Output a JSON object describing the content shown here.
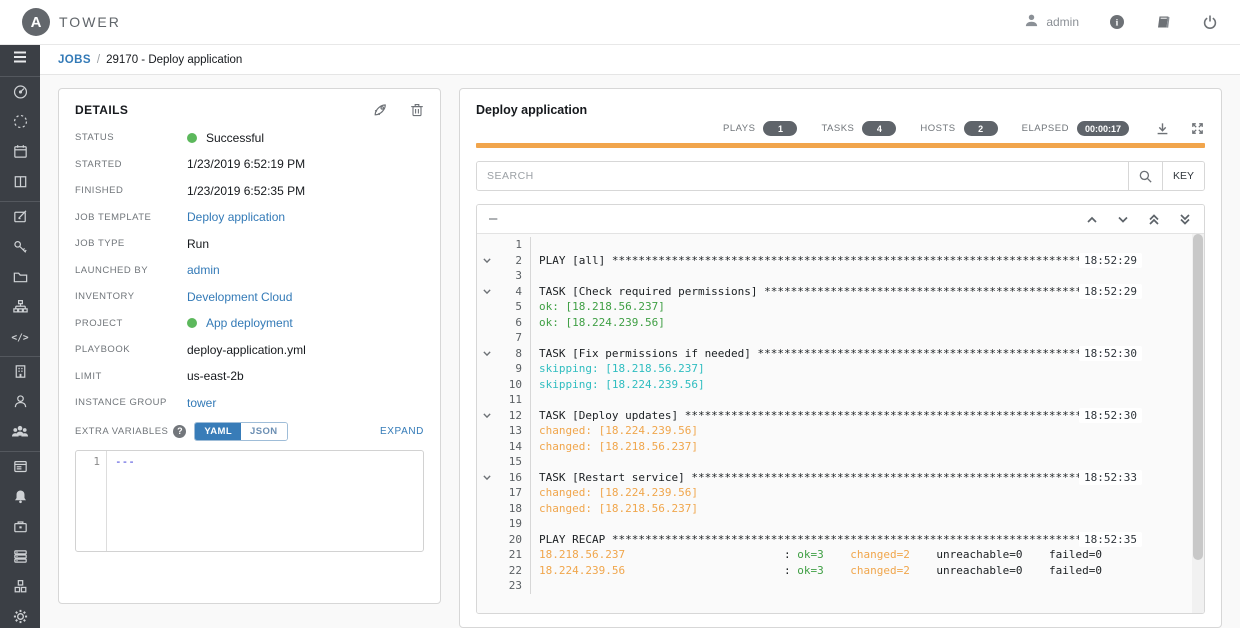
{
  "topbar": {
    "brand_letter": "A",
    "brand": "TOWER",
    "user": "admin",
    "icons": [
      "user-icon",
      "info-icon",
      "docs-icon",
      "power-icon"
    ]
  },
  "breadcrumb": {
    "root": "JOBS",
    "separator": "/",
    "current": "29170 - Deploy application"
  },
  "sidebar": {
    "items": [
      {
        "icon": "menu"
      },
      {
        "divider": true
      },
      {
        "icon": "dashboard"
      },
      {
        "icon": "jobs"
      },
      {
        "icon": "schedules"
      },
      {
        "icon": "portal"
      },
      {
        "divider": true
      },
      {
        "icon": "templates"
      },
      {
        "icon": "credentials"
      },
      {
        "icon": "projects"
      },
      {
        "icon": "inventories"
      },
      {
        "icon": "inventory-scripts"
      },
      {
        "divider": true
      },
      {
        "icon": "organizations"
      },
      {
        "icon": "users"
      },
      {
        "icon": "teams"
      },
      {
        "divider": true
      },
      {
        "icon": "credential-types"
      },
      {
        "icon": "notifications"
      },
      {
        "icon": "management-jobs"
      },
      {
        "icon": "instance-groups"
      },
      {
        "icon": "applications"
      },
      {
        "icon": "settings"
      }
    ]
  },
  "details": {
    "title": "DETAILS",
    "action_icons": [
      "relaunch-icon",
      "delete-icon"
    ],
    "rows": [
      {
        "label": "STATUS",
        "value": "Successful",
        "type": "status"
      },
      {
        "label": "STARTED",
        "value": "1/23/2019 6:52:19 PM",
        "type": "text"
      },
      {
        "label": "FINISHED",
        "value": "1/23/2019 6:52:35 PM",
        "type": "text"
      },
      {
        "label": "JOB TEMPLATE",
        "value": "Deploy application",
        "type": "link"
      },
      {
        "label": "JOB TYPE",
        "value": "Run",
        "type": "text"
      },
      {
        "label": "LAUNCHED BY",
        "value": "admin",
        "type": "link"
      },
      {
        "label": "INVENTORY",
        "value": "Development Cloud",
        "type": "link"
      },
      {
        "label": "PROJECT",
        "value": "App deployment",
        "type": "link-dot"
      },
      {
        "label": "PLAYBOOK",
        "value": "deploy-application.yml",
        "type": "text"
      },
      {
        "label": "LIMIT",
        "value": "us-east-2b",
        "type": "text"
      },
      {
        "label": "INSTANCE GROUP",
        "value": "tower",
        "type": "link"
      }
    ],
    "extra_variables": {
      "label": "EXTRA VARIABLES",
      "help": "?",
      "yaml_label": "YAML",
      "json_label": "JSON",
      "expand_label": "EXPAND",
      "editor_line_number": "1",
      "editor_content": "---"
    }
  },
  "output": {
    "title": "Deploy application",
    "stats": [
      {
        "label": "PLAYS",
        "value": "1"
      },
      {
        "label": "TASKS",
        "value": "4"
      },
      {
        "label": "HOSTS",
        "value": "2"
      },
      {
        "label": "ELAPSED",
        "value": "00:00:17"
      }
    ],
    "header_icons": [
      "download-icon",
      "expand-output-icon"
    ],
    "search_placeholder": "SEARCH",
    "key_button": "KEY",
    "toolbar": {
      "collapse_all": "–"
    },
    "lines": [
      {
        "num": "1",
        "segments": []
      },
      {
        "num": "2",
        "chevron": true,
        "ts": "18:52:29",
        "segments": [
          {
            "t": "PLAY [all] ************************************************************************",
            "c": "d"
          }
        ]
      },
      {
        "num": "3",
        "segments": []
      },
      {
        "num": "4",
        "chevron": true,
        "ts": "18:52:29",
        "segments": [
          {
            "t": "TASK [Check required permissions] *************************************************",
            "c": "d"
          }
        ]
      },
      {
        "num": "5",
        "segments": [
          {
            "t": "ok: [18.218.56.237]",
            "c": "g"
          }
        ]
      },
      {
        "num": "6",
        "segments": [
          {
            "t": "ok: [18.224.239.56]",
            "c": "g"
          }
        ]
      },
      {
        "num": "7",
        "segments": []
      },
      {
        "num": "8",
        "chevron": true,
        "ts": "18:52:30",
        "segments": [
          {
            "t": "TASK [Fix permissions if needed] **************************************************",
            "c": "d"
          }
        ]
      },
      {
        "num": "9",
        "segments": [
          {
            "t": "skipping: [18.218.56.237]",
            "c": "c"
          }
        ]
      },
      {
        "num": "10",
        "segments": [
          {
            "t": "skipping: [18.224.239.56]",
            "c": "c"
          }
        ]
      },
      {
        "num": "11",
        "segments": []
      },
      {
        "num": "12",
        "chevron": true,
        "ts": "18:52:30",
        "segments": [
          {
            "t": "TASK [Deploy updates] *************************************************************",
            "c": "d"
          }
        ]
      },
      {
        "num": "13",
        "segments": [
          {
            "t": "changed: [18.224.239.56]",
            "c": "o"
          }
        ]
      },
      {
        "num": "14",
        "segments": [
          {
            "t": "changed: [18.218.56.237]",
            "c": "o"
          }
        ]
      },
      {
        "num": "15",
        "segments": []
      },
      {
        "num": "16",
        "chevron": true,
        "ts": "18:52:33",
        "segments": [
          {
            "t": "TASK [Restart service] ************************************************************",
            "c": "d"
          }
        ]
      },
      {
        "num": "17",
        "segments": [
          {
            "t": "changed: [18.224.239.56]",
            "c": "o"
          }
        ]
      },
      {
        "num": "18",
        "segments": [
          {
            "t": "changed: [18.218.56.237]",
            "c": "o"
          }
        ]
      },
      {
        "num": "19",
        "segments": []
      },
      {
        "num": "20",
        "ts": "18:52:35",
        "segments": [
          {
            "t": "PLAY RECAP ************************************************************************",
            "c": "d"
          }
        ]
      },
      {
        "num": "21",
        "segments": [
          {
            "t": "18.218.56.237",
            "c": "o"
          },
          {
            "t": "                        : ",
            "c": "d"
          },
          {
            "t": "ok=3",
            "c": "g"
          },
          {
            "t": "    ",
            "c": "d"
          },
          {
            "t": "changed=2",
            "c": "o"
          },
          {
            "t": "    ",
            "c": "d"
          },
          {
            "t": "unreachable=0    failed=0",
            "c": "d"
          }
        ]
      },
      {
        "num": "22",
        "segments": [
          {
            "t": "18.224.239.56",
            "c": "o"
          },
          {
            "t": "                        : ",
            "c": "d"
          },
          {
            "t": "ok=3",
            "c": "g"
          },
          {
            "t": "    ",
            "c": "d"
          },
          {
            "t": "changed=2",
            "c": "o"
          },
          {
            "t": "    ",
            "c": "d"
          },
          {
            "t": "unreachable=0    failed=0",
            "c": "d"
          }
        ]
      },
      {
        "num": "23",
        "segments": []
      }
    ]
  },
  "colors": {
    "link_blue": "#337ab7",
    "status_green": "#5cb85c",
    "bar_orange": "#f1a54c",
    "sidebar_bg": "#3b3f45",
    "badge_bg": "#5f646a",
    "output_ok_green": "#3f9f44",
    "output_skip_cyan": "#2fbdc0",
    "output_changed_orange": "#f0a64c"
  }
}
